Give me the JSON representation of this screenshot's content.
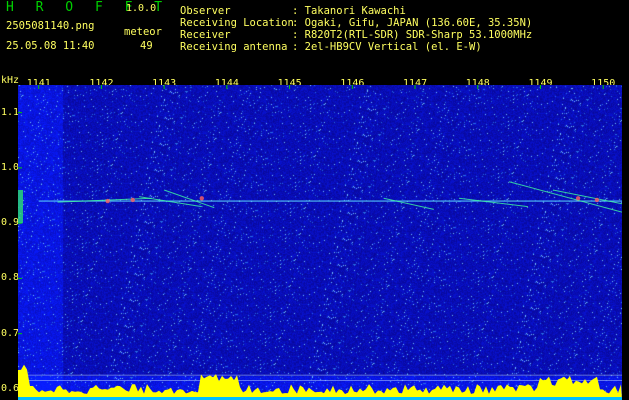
{
  "header": {
    "app_name": "H R O F F T",
    "version": "1.0.0",
    "filename": "2505081140.png",
    "datetime": "25.05.08 11:40",
    "meteor_label": "meteor",
    "meteor_count": "49",
    "info": [
      {
        "label": "Observer",
        "value": ": Takanori Kawachi"
      },
      {
        "label": "Receiving Location",
        "value": ": Ogaki, Gifu, JAPAN (136.60E, 35.35N)"
      },
      {
        "label": "Receiver",
        "value": ": R820T2(RTL-SDR) SDR-Sharp 53.1000MHz"
      },
      {
        "label": "Receiving antenna",
        "value": ": 2el-HB9CV Vertical (el. E-W)"
      }
    ]
  },
  "chart_data": {
    "type": "heatmap",
    "ylabel": "kHz",
    "y_ticks": [
      "1.1",
      "1.0",
      "0.9",
      "0.8",
      "0.7",
      "0.6"
    ],
    "y_range": [
      0.58,
      1.15
    ],
    "x_ticks": [
      "1141",
      "1142",
      "1143",
      "1144",
      "1145",
      "1146",
      "1147",
      "1148",
      "1149",
      "1150"
    ],
    "x_range": [
      1140.67,
      1150.3
    ],
    "background_color": "#0a1470",
    "carrier_freq": 0.94,
    "colors": {
      "text": "#ffff60",
      "tick": "#00d000",
      "noise": "#ffff00",
      "baseline": "#00c0ff"
    }
  }
}
